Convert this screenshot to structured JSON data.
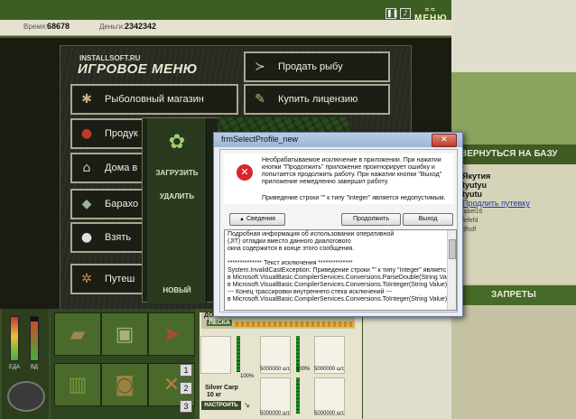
{
  "stats": {
    "time_label": "Время:",
    "time_value": "68678",
    "money_label": "Деньги:",
    "money_value": "2342342"
  },
  "topbar": {
    "icons": [
      "pause-icon",
      "music-icon"
    ],
    "menu_label": "МЕНЮ"
  },
  "brand": {
    "small": "INSTALLSOFT.RU",
    "big": "ИГРОВОЕ МЕНЮ"
  },
  "menu": {
    "left": [
      {
        "label": "Рыболовный магазин",
        "icon": "spider-icon"
      },
      {
        "label": "Продук",
        "icon": "berries-icon"
      },
      {
        "label": "Дома в",
        "icon": "house-icon"
      },
      {
        "label": "Барахо",
        "icon": "items-icon"
      },
      {
        "label": "Взять",
        "icon": "piggy-icon"
      },
      {
        "label": "Путеш",
        "icon": "wheel-icon"
      }
    ],
    "right": [
      {
        "label": "Продать рыбу",
        "icon": "fish-icon"
      },
      {
        "label": "Купить лицензию",
        "icon": "license-icon"
      }
    ]
  },
  "profile": {
    "load": "ЗАГРУЗИТЬ",
    "delete": "УДАЛИТЬ",
    "new": "НОВЫЙ"
  },
  "right": {
    "return": "ВЕРНУТЬСЯ НА БАЗУ",
    "chat": [
      "Якутия",
      "tyutyu",
      "tyutu"
    ],
    "link": "Продлить путевку",
    "small": [
      "label16",
      "fefefd",
      "dfsdf"
    ],
    "bans": "ЗАПРЕТЫ"
  },
  "gauges": {
    "left_label": "ЕДА",
    "right_label": "ВД"
  },
  "store": {
    "header_left": "ДО",
    "line_label": "ЛЕСКА",
    "slots": [
      {
        "pct": "100%",
        "qty": "5000000 шт."
      },
      {
        "pct": "100%",
        "qty": "5000000 шт."
      },
      {
        "pct": "",
        "qty": "5000000 шт."
      },
      {
        "pct": "",
        "qty": "5000000 шт."
      },
      {
        "pct": "",
        "qty": "5000000 шт."
      }
    ],
    "fish_name": "Silver Carp",
    "fish_weight": "10 кг",
    "setup": "НАСТРОИТЬ",
    "pages": [
      "1",
      "2",
      "3"
    ]
  },
  "dialog": {
    "title": "frmSelectProfile_new",
    "close": "✕",
    "msg1": "Необрабатываемое исключение в приложении. При нажатии кнопки \"Продолжить\" приложение проигнорирует ошибку и попытается продолжить работу. При нажатии кнопки \"Выход\" приложение немедленно завершит работу.",
    "msg2": "Приведение строки \"\" к типу \"Integer\" является недопустимым.",
    "details_button": "Сведения",
    "continue_button": "Продолжить",
    "exit_button": "Выход",
    "details": [
      "Подробная информация об использовании оперативной",
      "(JIT) отладки вместо данного диалогового",
      "окна содержится в конце этого сообщения.",
      "",
      "************** Текст исключения **************",
      "System.InvalidCastException: Приведение строки \"\" к типу \"Integer\" являетс",
      "   в Microsoft.VisualBasic.CompilerServices.Conversions.ParseDouble(String Valu",
      "   в Microsoft.VisualBasic.CompilerServices.Conversions.ToInteger(String Value)",
      "--- Конец трассировки внутреннего стека исключений ---",
      "   в Microsoft.VisualBasic.CompilerServices.Conversions.ToInteger(String Value)"
    ]
  }
}
